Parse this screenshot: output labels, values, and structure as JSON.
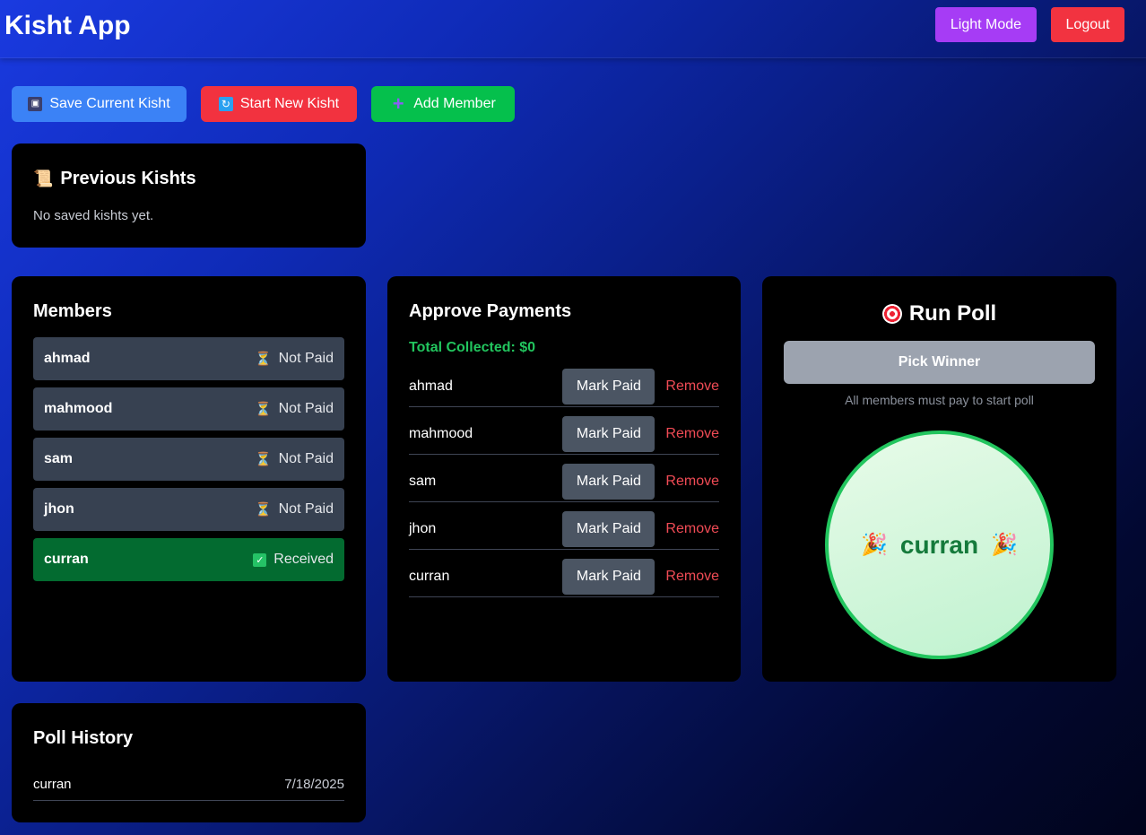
{
  "header": {
    "title": "Kisht App",
    "light_mode_label": "Light Mode",
    "logout_label": "Logout"
  },
  "actions": {
    "save_label": "Save Current Kisht",
    "new_label": "Start New Kisht",
    "add_label": "Add Member"
  },
  "previous": {
    "title": "Previous Kishts",
    "empty_text": "No saved kishts yet."
  },
  "members": {
    "title": "Members",
    "items": [
      {
        "name": "ahmad",
        "status": "Not Paid",
        "paid": false
      },
      {
        "name": "mahmood",
        "status": "Not Paid",
        "paid": false
      },
      {
        "name": "sam",
        "status": "Not Paid",
        "paid": false
      },
      {
        "name": "jhon",
        "status": "Not Paid",
        "paid": false
      },
      {
        "name": "curran",
        "status": "Received",
        "paid": true
      }
    ]
  },
  "approve": {
    "title": "Approve Payments",
    "total": "Total Collected: $0",
    "mark_label": "Mark Paid",
    "remove_label": "Remove",
    "rows": [
      "ahmad",
      "mahmood",
      "sam",
      "jhon",
      "curran"
    ]
  },
  "poll": {
    "title": "Run Poll",
    "pick_label": "Pick Winner",
    "note": "All members must pay to start poll",
    "winner": "curran"
  },
  "history": {
    "title": "Poll History",
    "entries": [
      {
        "name": "curran",
        "date": "7/18/2025"
      }
    ]
  },
  "colors": {
    "accent_purple": "#a63cf5",
    "danger": "#f23340",
    "primary": "#3b82f6",
    "success": "#05c04c",
    "paid_row": "#036b30"
  },
  "icons": {
    "save": "floppy-disk-icon",
    "new": "refresh-icon",
    "add": "plus-icon",
    "previous": "scroll-icon",
    "pending": "hourglass-icon",
    "received": "check-icon",
    "poll": "target-icon",
    "celebrate": "party-popper-icon"
  }
}
